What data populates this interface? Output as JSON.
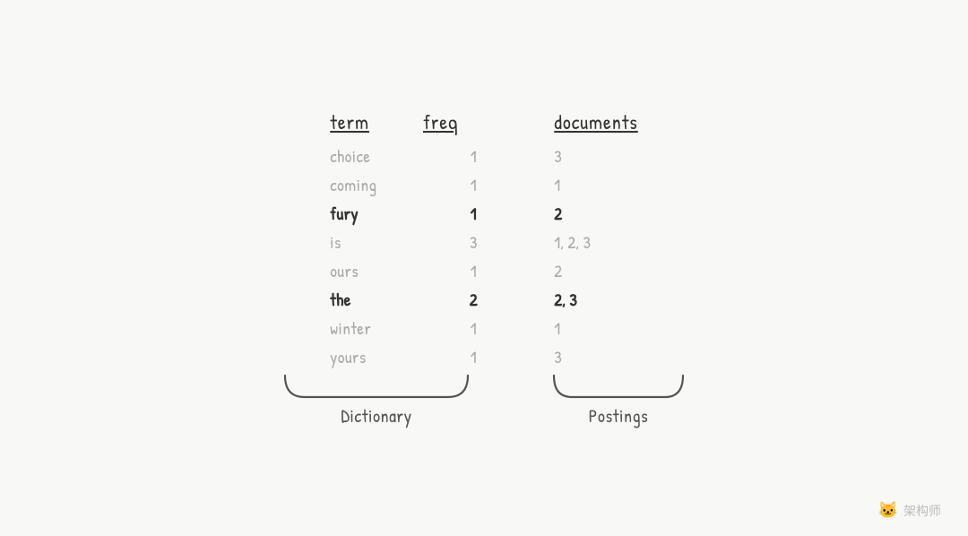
{
  "header": {
    "term_col": "term",
    "freq_col": "freq",
    "docs_col": "documents"
  },
  "dictionary_rows": [
    {
      "term": "choice",
      "freq": "1",
      "bold": false
    },
    {
      "term": "coming",
      "freq": "1",
      "bold": false
    },
    {
      "term": "fury",
      "freq": "1",
      "bold": true
    },
    {
      "term": "is",
      "freq": "3",
      "bold": false
    },
    {
      "term": "ours",
      "freq": "1",
      "bold": false
    },
    {
      "term": "the",
      "freq": "2",
      "bold": true
    },
    {
      "term": "winter",
      "freq": "1",
      "bold": false
    },
    {
      "term": "yours",
      "freq": "1",
      "bold": false
    }
  ],
  "postings_rows": [
    {
      "docs": "3",
      "bold": false
    },
    {
      "docs": "1",
      "bold": false
    },
    {
      "docs": "2",
      "bold": true
    },
    {
      "docs": "1, 2, 3",
      "bold": false
    },
    {
      "docs": "2",
      "bold": false
    },
    {
      "docs": "2, 3",
      "bold": true
    },
    {
      "docs": "1",
      "bold": false
    },
    {
      "docs": "3",
      "bold": false
    }
  ],
  "labels": {
    "dictionary": "Dictionary",
    "postings": "Postings"
  },
  "watermark": {
    "text": "架构师",
    "icon": "🐱"
  }
}
